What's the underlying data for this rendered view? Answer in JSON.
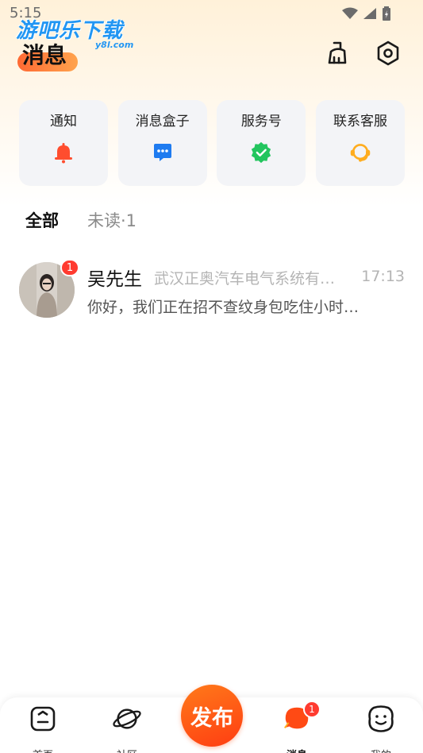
{
  "status_bar": {
    "time": "5:15"
  },
  "watermark": {
    "title": "游吧乐下载",
    "subtitle": "y8l.com"
  },
  "header": {
    "title": "消息"
  },
  "cards": [
    {
      "label": "通知",
      "icon": "bell-icon",
      "color": "#ff4d2e"
    },
    {
      "label": "消息盒子",
      "icon": "chat-bubble-icon",
      "color": "#1e7bf0"
    },
    {
      "label": "服务号",
      "icon": "verified-badge-icon",
      "color": "#22c55e"
    },
    {
      "label": "联系客服",
      "icon": "headset-icon",
      "color": "#ffad1f"
    }
  ],
  "tabs": {
    "all": "全部",
    "unread": "未读·1"
  },
  "messages": [
    {
      "name": "吴先生",
      "company": "武汉正奥汽车电气系统有…",
      "time": "17:13",
      "preview": "你好，我们正在招不查纹身包吃住小时…",
      "badge": "1"
    }
  ],
  "nav": {
    "home": "首页",
    "community": "社区",
    "publish": "发布",
    "messages": "消息",
    "messages_badge": "1",
    "mine": "我的"
  },
  "colors": {
    "accent": "#ff4a14",
    "badge": "#ff3b30",
    "card_bg": "#f3f4f7"
  }
}
